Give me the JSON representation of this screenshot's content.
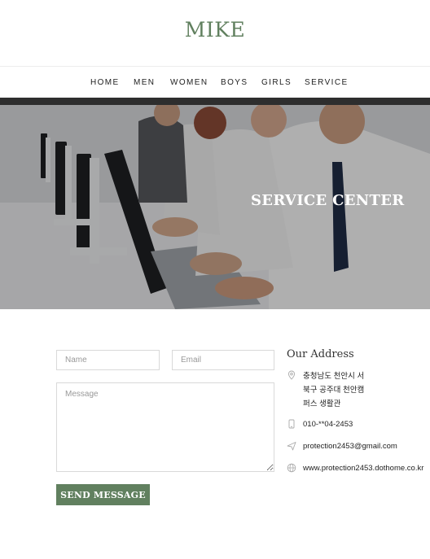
{
  "brand": {
    "logo": "MIKE",
    "accent_color": "#61805f"
  },
  "nav": {
    "items": [
      {
        "label": "HOME"
      },
      {
        "label": "MEN"
      },
      {
        "label": "WOMEN"
      },
      {
        "label": "BOYS"
      },
      {
        "label": "GIRLS"
      },
      {
        "label": "SERVICE"
      }
    ]
  },
  "hero": {
    "title": "SERVICE CENTER"
  },
  "form": {
    "name_placeholder": "Name",
    "email_placeholder": "Email",
    "message_placeholder": "Message",
    "submit_label": "SEND MESSAGE"
  },
  "address": {
    "title": "Our Address",
    "location_lines": [
      "충청남도 천안시 서",
      "북구 공주대 천안캠",
      "퍼스 생활관"
    ],
    "phone": "010-**04-2453",
    "email": "protection2453@gmail.com",
    "website": "www.protection2453.dothome.co.kr",
    "icons": [
      "location-pin-icon",
      "phone-icon",
      "send-icon",
      "globe-icon"
    ]
  }
}
